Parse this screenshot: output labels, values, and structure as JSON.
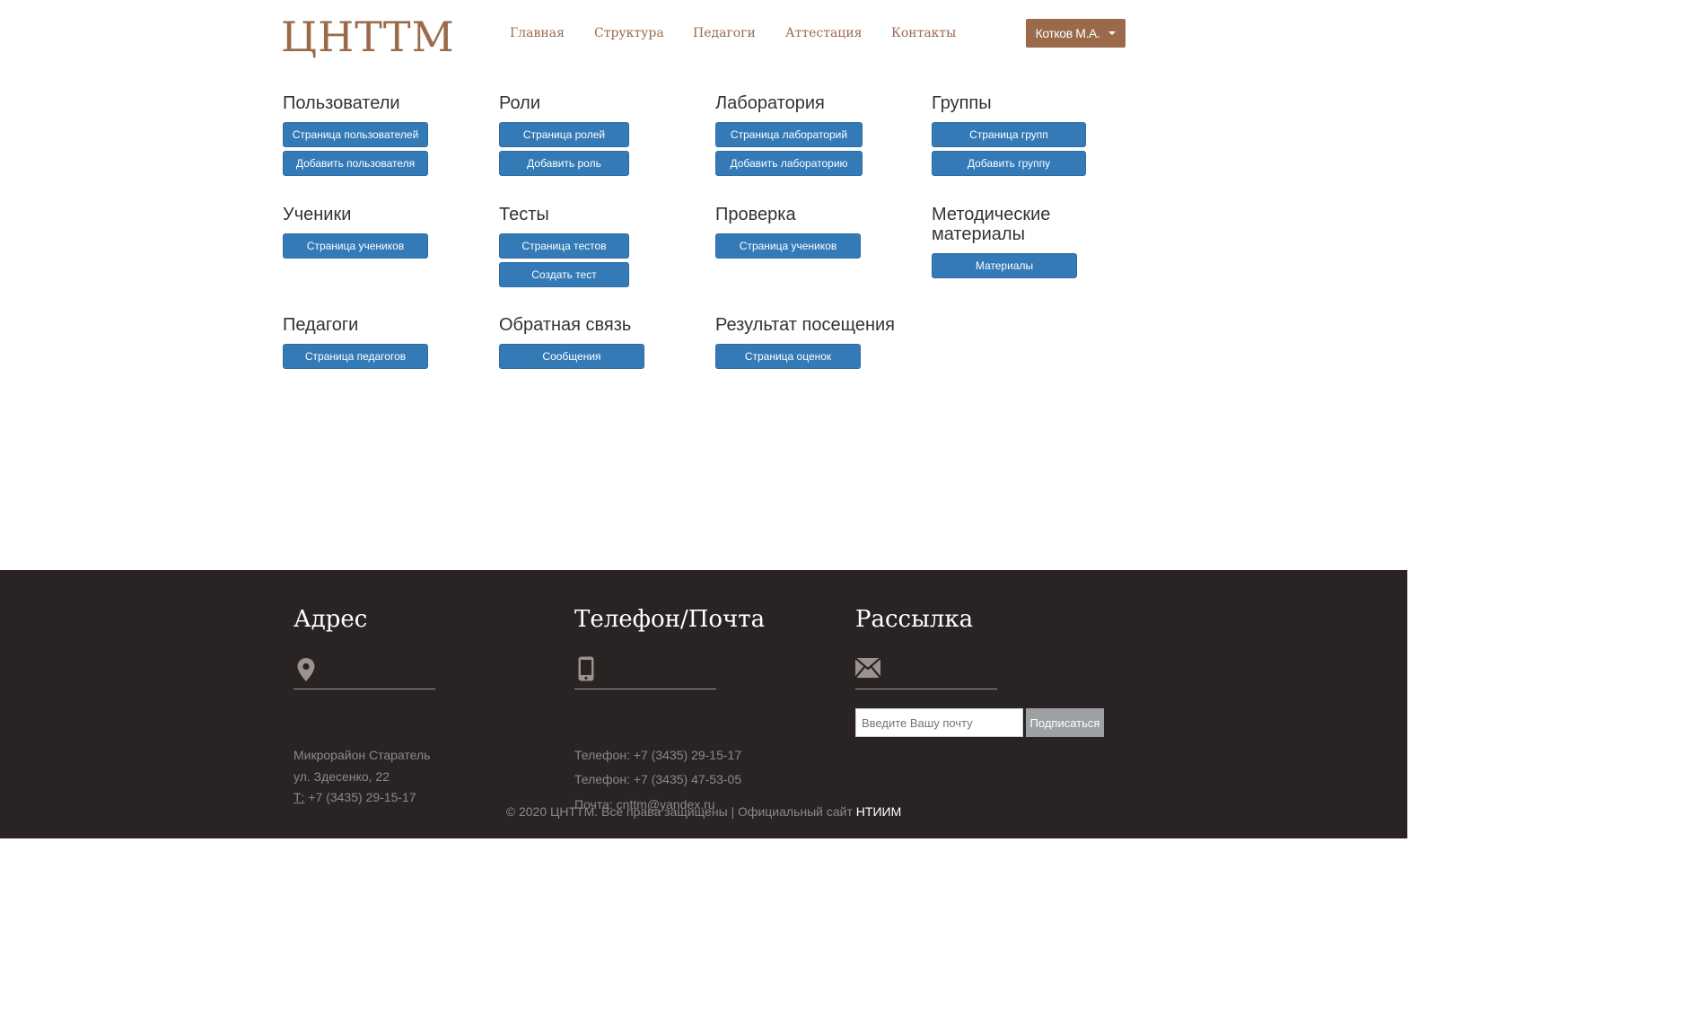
{
  "header": {
    "logo": "ЦНТТМ",
    "nav": [
      "Главная",
      "Структура",
      "Педагоги",
      "Аттестация",
      "Контакты"
    ],
    "user": "Котков М.А."
  },
  "sections": [
    {
      "title": "Пользователи",
      "buttons": [
        "Страница пользователей",
        "Добавить пользователя"
      ]
    },
    {
      "title": "Роли",
      "buttons": [
        "Страница ролей",
        "Добавить роль"
      ]
    },
    {
      "title": "Лаборатория",
      "buttons": [
        "Страница лабораторий",
        "Добавить лабораторию"
      ]
    },
    {
      "title": "Группы",
      "buttons": [
        "Страница групп",
        "Добавить группу"
      ]
    },
    {
      "title": "Ученики",
      "buttons": [
        "Страница учеников"
      ]
    },
    {
      "title": "Тесты",
      "buttons": [
        "Страница тестов",
        "Создать тест"
      ]
    },
    {
      "title": "Проверка",
      "buttons": [
        "Страница учеников"
      ]
    },
    {
      "title": "Методические материалы",
      "buttons": [
        "Материалы"
      ]
    },
    {
      "title": "Педагоги",
      "buttons": [
        "Страница педагогов"
      ]
    },
    {
      "title": "Обратная связь",
      "buttons": [
        "Сообщения"
      ]
    },
    {
      "title": "Результат посещения",
      "buttons": [
        "Страница оценок"
      ]
    }
  ],
  "footer": {
    "address": {
      "title": "Адрес",
      "icon": "map-pin-icon",
      "lines": [
        "Микрорайон Старатель",
        "ул. Здесенко, 22"
      ],
      "phone_prefix": "Т:",
      "phone": "+7 (3435) 29-15-17"
    },
    "contacts": {
      "title": "Телефон/Почта",
      "icon": "phone-icon",
      "lines": [
        "Телефон: +7 (3435) 29-15-17",
        "Телефон: +7 (3435) 47-53-05",
        "Почта: cnttm@yandex.ru"
      ]
    },
    "newsletter": {
      "title": "Рассылка",
      "icon": "envelope-icon",
      "placeholder": "Введите Вашу почту",
      "button": "Подписаться"
    },
    "copyright": "© 2020 ЦНТТМ. Все права защищены | Официальный сайт",
    "site_link": "НТИИМ"
  },
  "colors": {
    "brand": "#9a6a4b",
    "button": "#337ab7",
    "footer_bg": "#2a2323"
  }
}
